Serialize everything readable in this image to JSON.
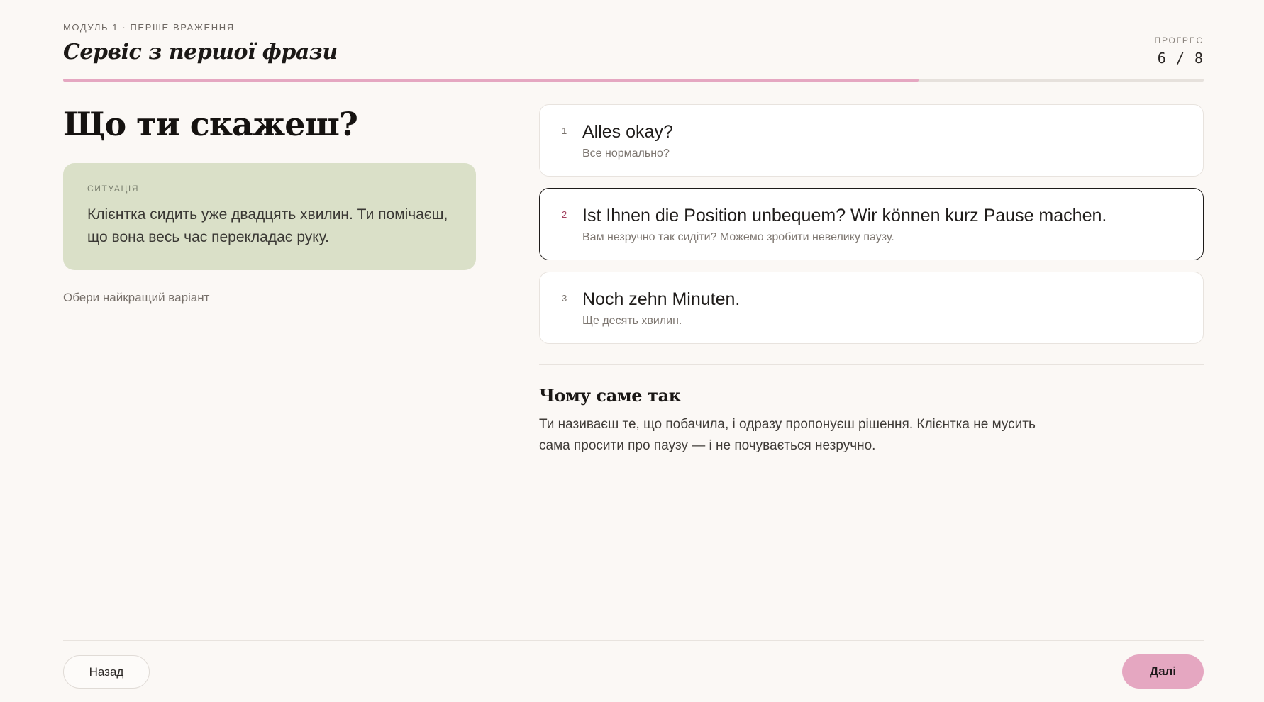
{
  "header": {
    "eyebrow": "МОДУЛЬ 1 · ПЕРШЕ ВРАЖЕННЯ",
    "module_title": "Сервіс з першої фрази",
    "progress_label": "ПРОГРЕС",
    "progress_text": "6 / 8",
    "progress_current": 6,
    "progress_total": 8
  },
  "main": {
    "question": "Що ти скажеш?",
    "situation": {
      "label": "СИТУАЦІЯ",
      "text": "Клієнтка сидить уже двадцять хвилин. Ти помічаєш, що вона весь час перекладає руку."
    },
    "hint": "Обери найкращий варіант"
  },
  "options": [
    {
      "number": "1",
      "de": "Alles okay?",
      "uk": "Все нормально?",
      "selected": false
    },
    {
      "number": "2",
      "de": "Ist Ihnen die Position unbequem? Wir können kurz Pause machen.",
      "uk": "Вам незручно так сидіти? Можемо зробити невелику паузу.",
      "selected": true
    },
    {
      "number": "3",
      "de": "Noch zehn Minuten.",
      "uk": "Ще десять хвилин.",
      "selected": false
    }
  ],
  "explanation": {
    "title": "Чому саме так",
    "text": "Ти називаєш те, що побачила, і одразу пропонуєш рішення. Клієнтка не мусить сама просити про паузу — і не почувається незручно."
  },
  "footer": {
    "back_label": "Назад",
    "next_label": "Далі"
  },
  "colors": {
    "accent": "#e5a7c1",
    "situation_bg": "#dae0c8",
    "background": "#fbf8f5"
  }
}
